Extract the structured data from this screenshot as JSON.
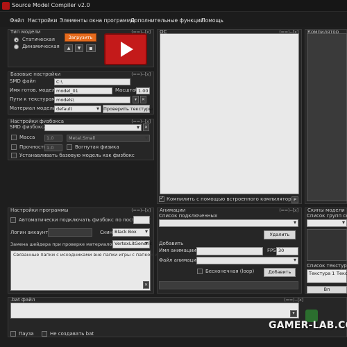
{
  "window": {
    "title": "Source Model Compiler v2.0"
  },
  "menu": [
    "Файл",
    "Настройки",
    "Элементы окна программы",
    "Дополнительные функции",
    "Помощь"
  ],
  "panel_controls": "(==)--[x]",
  "model_type": {
    "title": "Тип модели",
    "options": [
      "Статическая",
      "Динамическая"
    ],
    "selected": "Статическая",
    "add_button": "Загрузить",
    "up_icon": "arrow-up",
    "down_icon": "arrow-down",
    "save_icon": "floppy",
    "play_icon": "play",
    "accent": "#c41a1a"
  },
  "base_settings": {
    "title": "Базовые настройки",
    "smd_label": "SMD файл",
    "smd_value": "C:\\",
    "model_name_label": "Имя готов. модели",
    "model_name_value": "model_01",
    "scale_label": "Масштаб",
    "scale_value": "1.00",
    "texture_path_label": "Пути к текстурам",
    "texture_path_value": "models\\",
    "material_label": "Материал модели",
    "material_value": "default",
    "check_textures_button": "Проверить текстуры"
  },
  "physics": {
    "title": "Настройки физбокса",
    "smd_label": "SMD физбокса",
    "smd_value": "",
    "mass_label": "Масса",
    "mass_value": "1.0",
    "material_value": "Metal.Small",
    "strength_label": "Прочность",
    "strength_value": "1.0",
    "concave_label": "Вогнутая физика",
    "base_model_label": "Устанавливать базовую модель как физбокс"
  },
  "qc": {
    "title": "QC",
    "compile_label": "Компилить с помощью встроенного компилятора",
    "compile_checked": true,
    "p_button": "P"
  },
  "compiler": {
    "title": "Компилятор"
  },
  "program_settings": {
    "title": "Настройки программы",
    "auto_physbox_label": "Автоматически подключать физбокс по постфиксу",
    "login_label": "Логин аккаунта",
    "skin_label": "Скин",
    "skin_value": "Black Box",
    "shader_label": "Замена шейдера при проверке материалов на",
    "shader_value": "VertexLitGeneric",
    "linked_folders_label": "Связанные папки с исходниками вне папки игры с папкой игры"
  },
  "animations": {
    "title": "Анимации",
    "list_label": "Список подключенных",
    "delete_button": "Удалить",
    "add_label": "Добавить",
    "anim_name_label": "Имя анимации",
    "fps_label": "FPS",
    "fps_value": "30",
    "anim_file_label": "Файл анимации",
    "loop_label": "Бесконечная (loop)",
    "add_button": "Добавить"
  },
  "skins": {
    "title": "Скины модели",
    "groups_label": "Список групп скинов",
    "textures_label": "Список текстур гру",
    "col1": "Текстура 1",
    "col2": "Текс",
    "bottom_button": "Вп"
  },
  "bat": {
    "title": ".bat файл",
    "pause_label": "Пауза",
    "no_create_label": "Не создавать bat"
  },
  "watermark": "GAMER-LAB.COM"
}
